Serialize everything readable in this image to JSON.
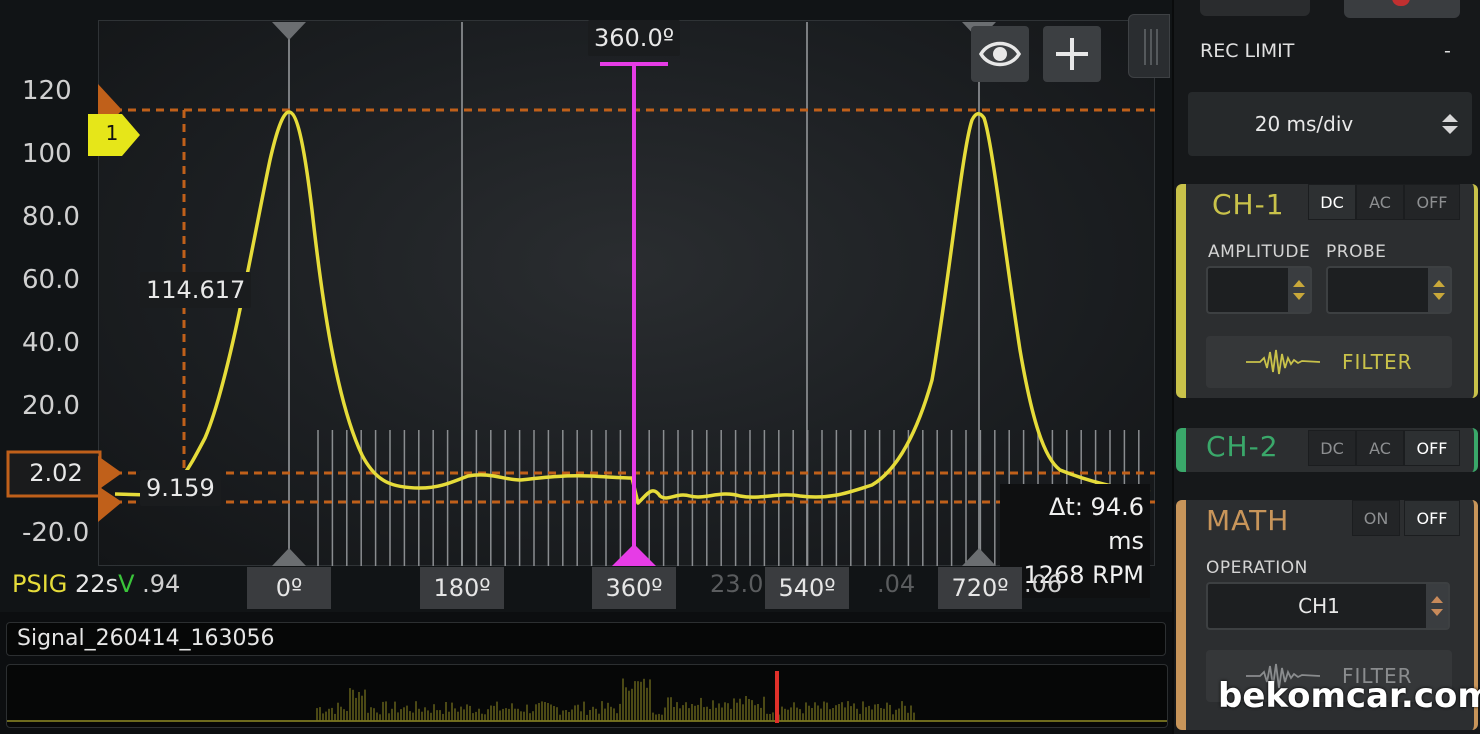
{
  "scope": {
    "y_axis_ticks": [
      "120",
      "100",
      "80.0",
      "60.0",
      "40.0",
      "20.0",
      "-20.0"
    ],
    "cursor_top_label": "360.0º",
    "level_marker": "2.02",
    "trigger_marker": "1",
    "readout_high": "114.617",
    "readout_low": "9.159",
    "delta_time": "Δt: 94.6 ms",
    "rpm": "1268 RPM",
    "degree_labels": [
      "0º",
      "180º",
      "360º",
      "540º",
      "720º"
    ],
    "bottom_status": {
      "psig": "PSIG",
      "time": "22s",
      "v": "V",
      "v_value": ".94",
      "mid1": "23.0",
      "mid2": ".04",
      "right": ".06"
    },
    "colors": {
      "trace": "#e6dc3a",
      "cursor": "#e63ce6",
      "marker": "#c0601a",
      "trigger": "#e6e619"
    }
  },
  "file": {
    "name": "Signal_260414_163056"
  },
  "panel": {
    "rec_limit_label": "REC LIMIT",
    "rec_limit_value": "-",
    "timebase": "20 ms/div",
    "ch1": {
      "title": "CH-1",
      "modes": [
        "DC",
        "AC",
        "OFF"
      ],
      "selected": "DC",
      "amplitude_label": "AMPLITUDE",
      "probe_label": "PROBE",
      "filter_label": "FILTER",
      "accent": "#c9c24a"
    },
    "ch2": {
      "title": "CH-2",
      "modes": [
        "DC",
        "AC",
        "OFF"
      ],
      "selected": "OFF",
      "accent": "#3aa86a"
    },
    "math": {
      "title": "MATH",
      "modes": [
        "ON",
        "OFF"
      ],
      "selected": "OFF",
      "operation_label": "OPERATION",
      "operation_value": "CH1",
      "filter_label": "FILTER",
      "accent": "#c8955a"
    }
  },
  "watermark": "bekomcar.com"
}
